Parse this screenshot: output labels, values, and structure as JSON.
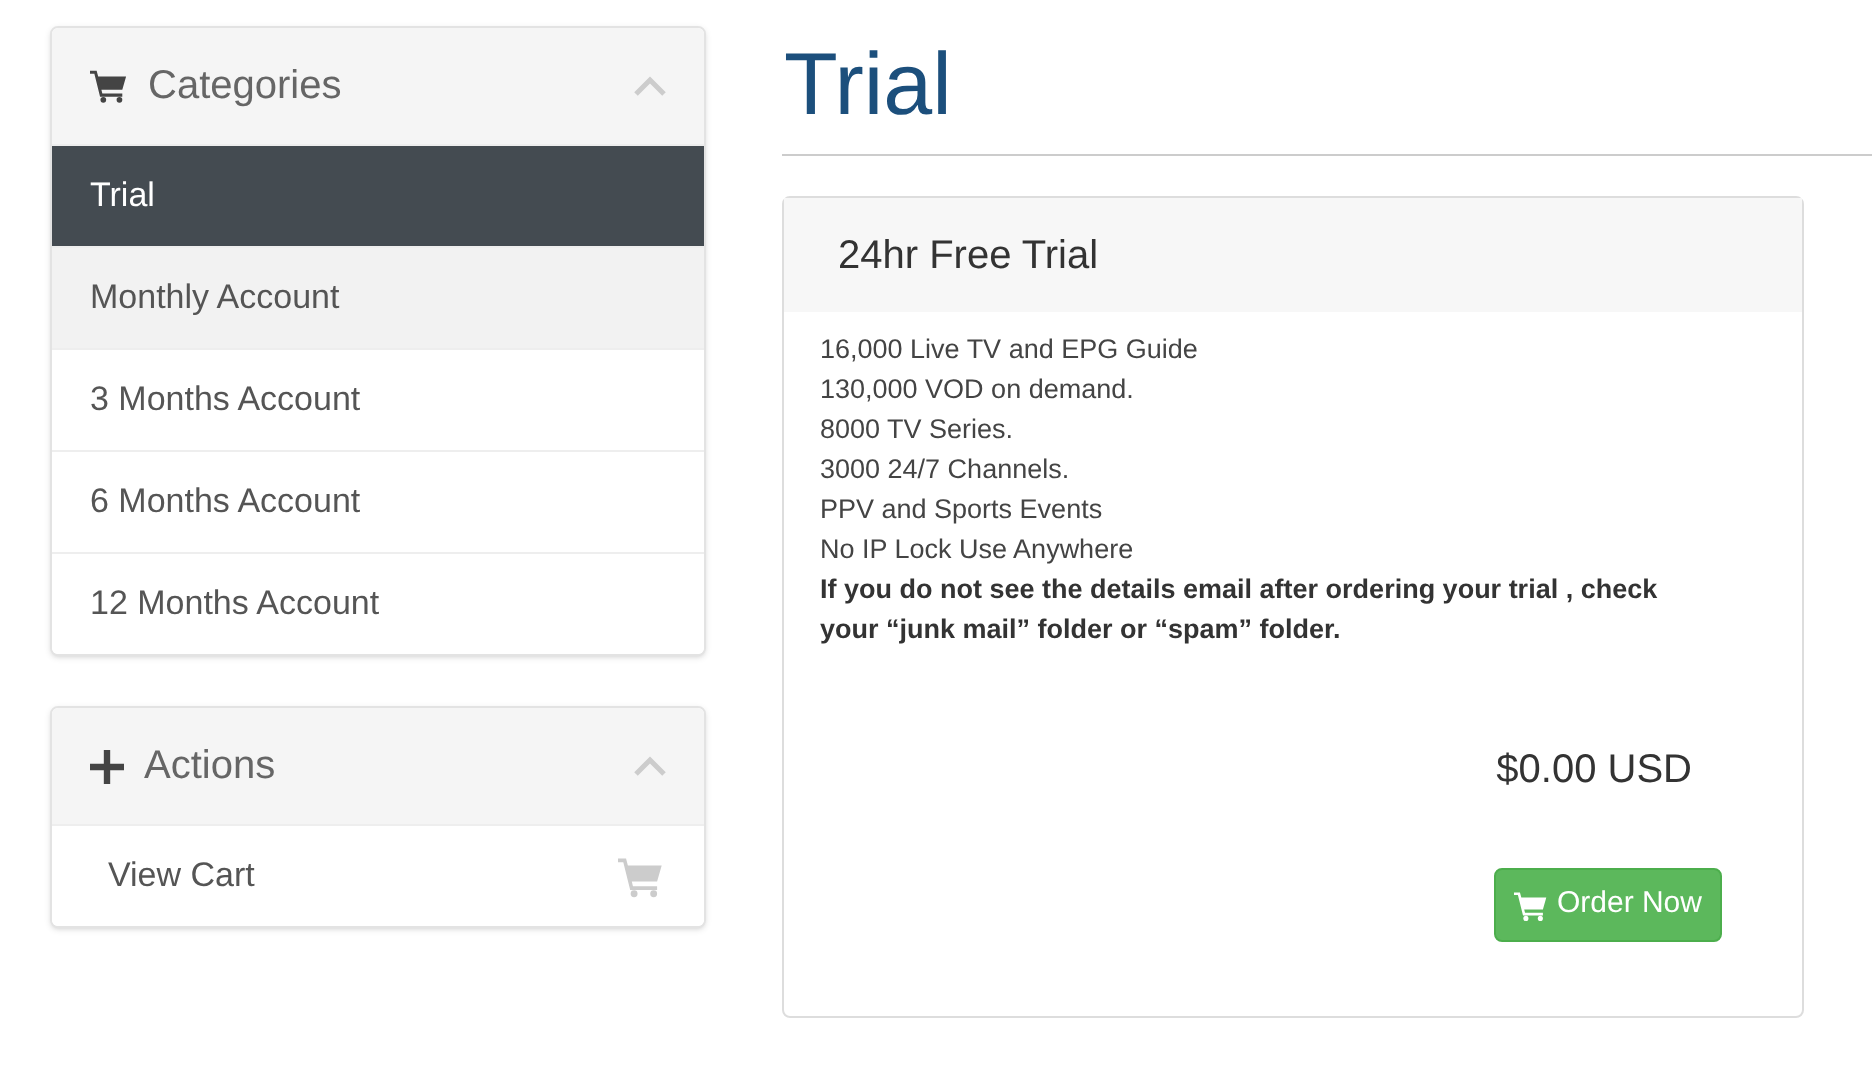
{
  "sidebar": {
    "panels": [
      {
        "kind": "categories",
        "title": "Categories",
        "collapse_icon": true,
        "items": [
          {
            "label": "Trial",
            "selected": true,
            "highlighted": false
          },
          {
            "label": "Monthly Account",
            "selected": false,
            "highlighted": true
          },
          {
            "label": "3 Months Account",
            "selected": false,
            "highlighted": false
          },
          {
            "label": "6 Months Account",
            "selected": false,
            "highlighted": false
          },
          {
            "label": "12 Months Account",
            "selected": false,
            "highlighted": false
          }
        ]
      },
      {
        "kind": "actions",
        "title": "Actions",
        "collapse_icon": true,
        "items": [
          {
            "label": "View Cart",
            "selected": false,
            "highlighted": false
          }
        ]
      }
    ]
  },
  "page_title": "Trial",
  "product": {
    "name": "24hr Free Trial",
    "features": [
      {
        "kind": "line",
        "text": "16,000 Live TV and EPG Guide"
      },
      {
        "kind": "line",
        "text": "130,000 VOD on demand."
      },
      {
        "kind": "line",
        "text": "8000 TV Series."
      },
      {
        "kind": "line",
        "text": "3000 24/7 Channels."
      },
      {
        "kind": "line",
        "text": "PPV and Sports Events"
      },
      {
        "kind": "line",
        "text": "No IP Lock Use Anywhere"
      },
      {
        "kind": "note",
        "text": "If you do not see the details email after ordering your trial , check your “junk mail” folder or “spam” folder."
      }
    ],
    "price": "$0.00 USD",
    "order_button": "Order Now"
  }
}
